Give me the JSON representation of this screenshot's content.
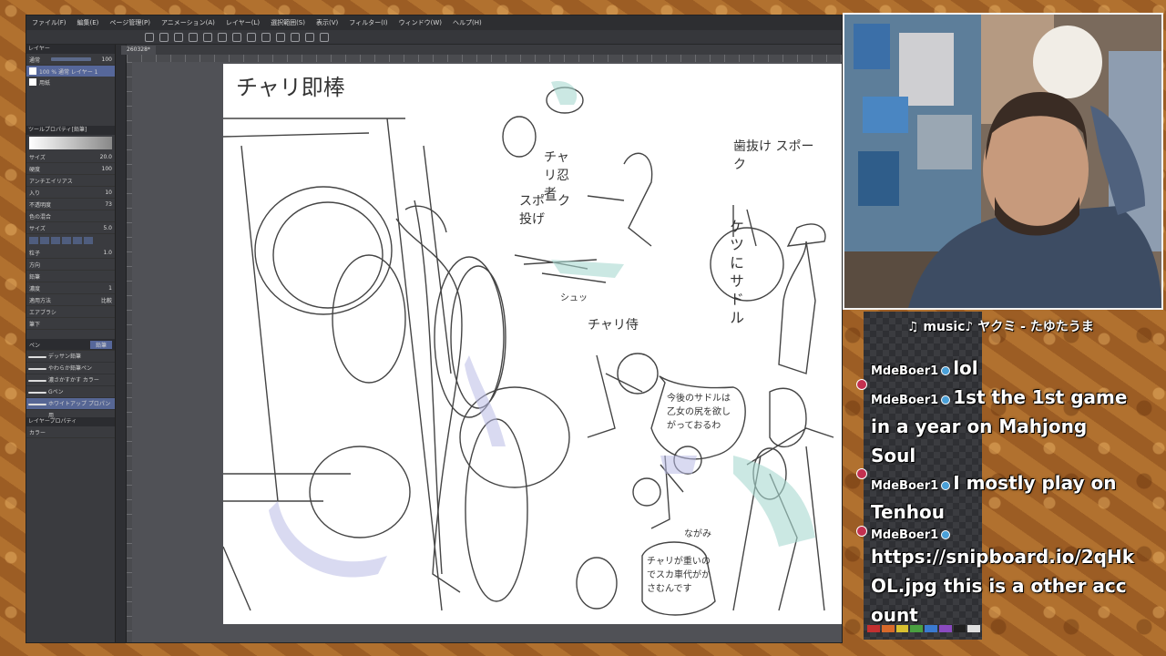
{
  "app": {
    "menu": [
      "ファイル(F)",
      "編集(E)",
      "ページ管理(P)",
      "アニメーション(A)",
      "レイヤー(L)",
      "選択範囲(S)",
      "表示(V)",
      "フィルター(I)",
      "ウィンドウ(W)",
      "ヘルプ(H)"
    ],
    "doc_tab": "260328*",
    "layer_panel": {
      "title": "レイヤー",
      "blend": "通常",
      "opacity": "100",
      "layers": [
        {
          "name": "100 % 通常 レイヤー 1"
        },
        {
          "name": "用紙"
        }
      ]
    },
    "tool_property": {
      "title": "ツールプロパティ[鉛筆]",
      "rows": [
        {
          "label": "サイズ",
          "value": "20.0"
        },
        {
          "label": "硬度",
          "value": "100"
        },
        {
          "label": "アンチエイリアス",
          "value": ""
        },
        {
          "label": "入り",
          "value": "10"
        },
        {
          "label": "不透明度",
          "value": "73"
        },
        {
          "label": "色の混合",
          "value": ""
        },
        {
          "label": "サイズ",
          "value": "5.0"
        },
        {
          "label": "密度",
          "value": ""
        },
        {
          "label": "粒子",
          "value": "1.0"
        },
        {
          "label": "間隔",
          "value": ""
        },
        {
          "label": "方向",
          "value": ""
        },
        {
          "label": "鉛筆",
          "value": ""
        },
        {
          "label": "濃度",
          "value": "1"
        },
        {
          "label": "適用方法",
          "value": "比較"
        },
        {
          "label": "エアブラシ",
          "value": ""
        },
        {
          "label": "紙質",
          "value": ""
        },
        {
          "label": "筆下",
          "value": ""
        }
      ]
    },
    "sub_tool": {
      "tabs": [
        "ペン",
        "鉛筆"
      ],
      "items": [
        "デッサン鉛筆",
        "やわらか鉛筆ペン",
        "濃さかすかす カラー",
        "Gペン",
        "ホワイトアップ プロパン用"
      ]
    },
    "color_panel": {
      "title": "レイヤープロパティ",
      "mode": "カラー"
    }
  },
  "canvas_texts": [
    {
      "text": "チャリ即棒",
      "cls": "big"
    },
    {
      "text": "チャリ忍者",
      "cls": ""
    },
    {
      "text": "スポーク投げ",
      "cls": ""
    },
    {
      "text": "歯抜け スポーク",
      "cls": ""
    },
    {
      "text": "ケツにサドル",
      "cls": "vert"
    },
    {
      "text": "シュッ",
      "cls": "small"
    },
    {
      "text": "チャリ侍",
      "cls": ""
    },
    {
      "text": "今後のサドルは 乙女の尻を欲しがっておるわ",
      "cls": "small"
    },
    {
      "text": "ながみ",
      "cls": "small"
    },
    {
      "text": "チャリが重いのでスカ車代がかさむんです",
      "cls": "small"
    }
  ],
  "stream": {
    "music": "♫ music♪ ヤクミ - たゆたうま",
    "chat": [
      {
        "author": "MdeBoer1",
        "text": "lol"
      },
      {
        "author": "MdeBoer1",
        "text": "1st the 1st game in a year on Mahjong Soul"
      },
      {
        "author": "MdeBoer1",
        "text": "I mostly play on Tenhou"
      },
      {
        "author": "MdeBoer1",
        "text": "https://snipboard.io/2qHkOL.jpg this is a other account"
      }
    ],
    "palette": [
      "#c43030",
      "#d86a2a",
      "#d8c030",
      "#4aa040",
      "#3a7ad0",
      "#8a4ac0",
      "#202020",
      "#e0e0e0"
    ]
  }
}
